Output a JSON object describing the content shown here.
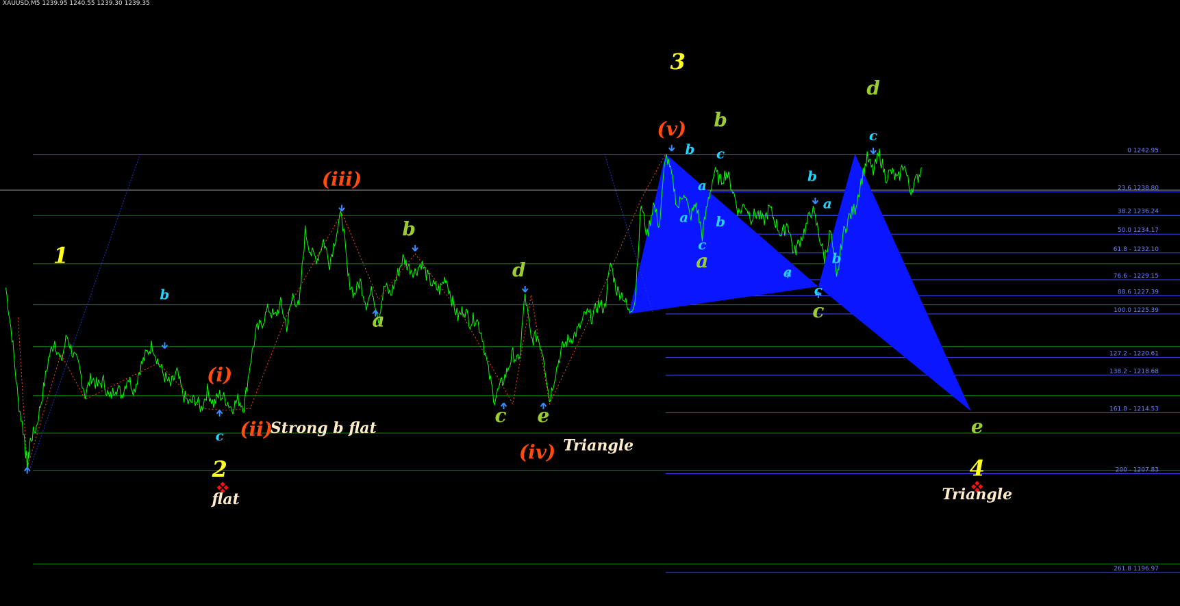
{
  "header": {
    "symbol_line": "XAUUSD,M5  1239.95 1240.55 1239.30 1239.35"
  },
  "colors": {
    "background": "#000000",
    "price": "#00ff00",
    "fib_line": "#3a4cff",
    "fib_text": "#6f82ff",
    "level_line": "#0a8a0a",
    "zigzag": "#ff4a1a",
    "pattern_fill": "#0a16ff",
    "primary_label": "#ffff22",
    "intermediate_label": "#ff4a10",
    "minor_label": "#9ccc34",
    "minute_label": "#22d4ff",
    "comment": "#ffeccc",
    "arrow": "#3a8cff",
    "marker": "#ff1010"
  },
  "chart_data": {
    "type": "line",
    "title": "",
    "xlabel": "",
    "ylabel": "",
    "ylim": [
      1195.5,
      1260.5
    ],
    "fib_levels": [
      {
        "label": "0 1242.95",
        "value": 1242.95
      },
      {
        "label": "23.6 1238.80",
        "value": 1238.8
      },
      {
        "label": "38.2 1236.24",
        "value": 1236.24
      },
      {
        "label": "50.0 1234.17",
        "value": 1234.17
      },
      {
        "label": "61.8 - 1232.10",
        "value": 1232.1
      },
      {
        "label": "76.6 - 1229.15",
        "value": 1229.15
      },
      {
        "label": "88.6 1227.39",
        "value": 1227.39
      },
      {
        "label": "100.0 1225.39",
        "value": 1225.39
      },
      {
        "label": "127.2 - 1220.61",
        "value": 1220.61
      },
      {
        "label": "138.2 - 1218.68",
        "value": 1218.68
      },
      {
        "label": "161.8 - 1214.53",
        "value": 1214.53
      },
      {
        "label": "200 - 1207.83",
        "value": 1207.83
      },
      {
        "label": "261.8 1196.97",
        "value": 1196.97
      }
    ],
    "horizontal_levels": [
      1242.95,
      1236.2,
      1230.9,
      1226.4,
      1221.8,
      1216.4,
      1212.3,
      1208.2,
      1197.9
    ],
    "current_price": 1239.0,
    "price_path": [
      [
        0,
        1228.3
      ],
      [
        1,
        1223.0
      ],
      [
        2,
        1216.0
      ],
      [
        3,
        1212.0
      ],
      [
        3.5,
        1208.5
      ],
      [
        4,
        1211.5
      ],
      [
        5,
        1213.0
      ],
      [
        6,
        1216.5
      ],
      [
        7,
        1220.5
      ],
      [
        8,
        1222.5
      ],
      [
        9,
        1220.0
      ],
      [
        10,
        1223.0
      ],
      [
        11,
        1221.0
      ],
      [
        12,
        1219.5
      ],
      [
        13,
        1216.5
      ],
      [
        14,
        1218.5
      ],
      [
        15,
        1217.5
      ],
      [
        16,
        1218.0
      ],
      [
        17,
        1216.0
      ],
      [
        18,
        1217.5
      ],
      [
        19,
        1216.5
      ],
      [
        20,
        1218.5
      ],
      [
        21,
        1217.0
      ],
      [
        22,
        1219.5
      ],
      [
        23,
        1221.0
      ],
      [
        24,
        1222.0
      ],
      [
        25,
        1220.0
      ],
      [
        26,
        1218.5
      ],
      [
        27,
        1217.5
      ],
      [
        28,
        1219.0
      ],
      [
        29,
        1216.5
      ],
      [
        30,
        1215.5
      ],
      [
        31,
        1216.0
      ],
      [
        32,
        1215.0
      ],
      [
        33,
        1217.0
      ],
      [
        34,
        1215.5
      ],
      [
        35,
        1216.5
      ],
      [
        36,
        1216.0
      ],
      [
        37,
        1215.0
      ],
      [
        38,
        1216.0
      ],
      [
        39,
        1215.2
      ],
      [
        40,
        1220.0
      ],
      [
        41,
        1223.5
      ],
      [
        42,
        1224.5
      ],
      [
        43,
        1226.0
      ],
      [
        44,
        1225.0
      ],
      [
        45,
        1226.5
      ],
      [
        46,
        1224.0
      ],
      [
        47,
        1227.5
      ],
      [
        48,
        1226.0
      ],
      [
        49,
        1234.5
      ],
      [
        50,
        1232.0
      ],
      [
        51,
        1231.5
      ],
      [
        52,
        1233.5
      ],
      [
        53,
        1231.0
      ],
      [
        54,
        1234.0
      ],
      [
        55,
        1236.5
      ],
      [
        56,
        1229.5
      ],
      [
        57,
        1227.5
      ],
      [
        58,
        1229.0
      ],
      [
        59,
        1226.5
      ],
      [
        60,
        1228.0
      ],
      [
        61,
        1225.0
      ],
      [
        62,
        1228.5
      ],
      [
        63,
        1227.5
      ],
      [
        64,
        1229.5
      ],
      [
        65,
        1231.5
      ],
      [
        66,
        1230.5
      ],
      [
        67,
        1230.0
      ],
      [
        68,
        1231.0
      ],
      [
        69,
        1229.5
      ],
      [
        70,
        1228.5
      ],
      [
        71,
        1228.0
      ],
      [
        72,
        1229.5
      ],
      [
        73,
        1227.0
      ],
      [
        74,
        1225.0
      ],
      [
        75,
        1226.0
      ],
      [
        76,
        1224.5
      ],
      [
        77,
        1225.0
      ],
      [
        78,
        1223.0
      ],
      [
        79,
        1219.0
      ],
      [
        80,
        1216.0
      ],
      [
        81,
        1217.5
      ],
      [
        82,
        1219.0
      ],
      [
        83,
        1221.0
      ],
      [
        84,
        1220.0
      ],
      [
        85,
        1227.5
      ],
      [
        86,
        1222.5
      ],
      [
        87,
        1223.0
      ],
      [
        88,
        1221.0
      ],
      [
        89,
        1216.0
      ],
      [
        90,
        1219.0
      ],
      [
        91,
        1221.5
      ],
      [
        92,
        1222.5
      ],
      [
        93,
        1223.0
      ],
      [
        94,
        1224.0
      ],
      [
        95,
        1225.5
      ],
      [
        96,
        1225.0
      ],
      [
        97,
        1226.5
      ],
      [
        98,
        1226.0
      ],
      [
        99,
        1231.0
      ],
      [
        100,
        1228.0
      ],
      [
        101,
        1227.5
      ],
      [
        102,
        1225.5
      ],
      [
        103,
        1227.0
      ],
      [
        104,
        1237.5
      ],
      [
        105,
        1234.0
      ],
      [
        106,
        1237.5
      ],
      [
        107,
        1235.0
      ],
      [
        108,
        1243.0
      ],
      [
        109,
        1240.5
      ],
      [
        110,
        1237.0
      ],
      [
        111,
        1239.0
      ],
      [
        112,
        1236.0
      ],
      [
        113,
        1237.5
      ],
      [
        114,
        1234.0
      ],
      [
        115,
        1238.0
      ],
      [
        116,
        1241.0
      ],
      [
        117,
        1240.0
      ],
      [
        118,
        1241.0
      ],
      [
        119,
        1239.0
      ],
      [
        120,
        1236.5
      ],
      [
        121,
        1237.5
      ],
      [
        122,
        1236.0
      ],
      [
        123,
        1236.5
      ],
      [
        124,
        1235.5
      ],
      [
        125,
        1237.0
      ],
      [
        126,
        1235.5
      ],
      [
        127,
        1234.0
      ],
      [
        128,
        1235.5
      ],
      [
        129,
        1232.0
      ],
      [
        130,
        1233.5
      ],
      [
        131,
        1235.0
      ],
      [
        132,
        1237.0
      ],
      [
        133,
        1234.5
      ],
      [
        134,
        1231.5
      ],
      [
        135,
        1234.5
      ],
      [
        136,
        1229.0
      ],
      [
        137,
        1234.0
      ],
      [
        138,
        1236.0
      ],
      [
        139,
        1237.0
      ],
      [
        140,
        1240.0
      ],
      [
        141,
        1242.5
      ],
      [
        142,
        1241.0
      ],
      [
        143,
        1243.0
      ],
      [
        144,
        1240.5
      ],
      [
        145,
        1241.0
      ],
      [
        146,
        1240.0
      ],
      [
        147,
        1242.0
      ],
      [
        148,
        1239.0
      ],
      [
        149,
        1240.0
      ],
      [
        150,
        1241.5
      ]
    ],
    "zigzag": [
      [
        2,
        1225.0
      ],
      [
        3.5,
        1208.5
      ],
      [
        9,
        1221.0
      ],
      [
        13,
        1216.0
      ],
      [
        25,
        1220.0
      ],
      [
        32,
        1215.0
      ],
      [
        36,
        1214.8
      ],
      [
        40,
        1215.0
      ],
      [
        47,
        1227.0
      ],
      [
        55,
        1236.5
      ],
      [
        61,
        1227.0
      ],
      [
        67,
        1232.0
      ],
      [
        75,
        1225.0
      ],
      [
        83,
        1215.5
      ],
      [
        86,
        1227.5
      ],
      [
        89,
        1215.5
      ],
      [
        96,
        1225.5
      ],
      [
        104,
        1238.0
      ],
      [
        108,
        1243.0
      ]
    ],
    "trendlines": [
      {
        "from": [
          4,
          1208.5
        ],
        "to": [
          22,
          1243.0
        ]
      },
      {
        "from": [
          98,
          1243.0
        ],
        "to": [
          106,
          1225.4
        ]
      }
    ],
    "harmonic_pattern": [
      [
        102,
        1225.4
      ],
      [
        108,
        1243.0
      ],
      [
        133,
        1228.4
      ],
      [
        139,
        1243.0
      ],
      [
        158,
        1214.7
      ]
    ],
    "labels": [
      {
        "text": "1",
        "x": 9,
        "y": 1231.0,
        "level": "primary"
      },
      {
        "text": "2",
        "x": 35,
        "y": 1207.5,
        "level": "primary"
      },
      {
        "text": "3",
        "x": 110,
        "y": 1252.3,
        "level": "primary"
      },
      {
        "text": "4",
        "x": 159,
        "y": 1207.6,
        "level": "primary"
      },
      {
        "text": "(i)",
        "x": 35,
        "y": 1218.0,
        "level": "intermediate"
      },
      {
        "text": "(ii)",
        "x": 41,
        "y": 1212.0,
        "level": "intermediate"
      },
      {
        "text": "(iii)",
        "x": 55,
        "y": 1239.5,
        "level": "intermediate"
      },
      {
        "text": "(iv)",
        "x": 87,
        "y": 1209.5,
        "level": "intermediate"
      },
      {
        "text": "(v)",
        "x": 109,
        "y": 1245.0,
        "level": "intermediate"
      },
      {
        "text": "b",
        "x": 26,
        "y": 1227.0,
        "level": "minute"
      },
      {
        "text": "c",
        "x": 35,
        "y": 1211.5,
        "level": "minute"
      },
      {
        "text": "b",
        "x": 66,
        "y": 1234.0,
        "level": "minor"
      },
      {
        "text": "a",
        "x": 61,
        "y": 1224.0,
        "level": "minor"
      },
      {
        "text": "d",
        "x": 84,
        "y": 1229.5,
        "level": "minor"
      },
      {
        "text": "c",
        "x": 81,
        "y": 1213.5,
        "level": "minor"
      },
      {
        "text": "e",
        "x": 88,
        "y": 1213.5,
        "level": "minor"
      },
      {
        "text": "b",
        "x": 117,
        "y": 1246.0,
        "level": "minor"
      },
      {
        "text": "a",
        "x": 114,
        "y": 1230.5,
        "level": "minor"
      },
      {
        "text": "c",
        "x": 133,
        "y": 1225.0,
        "level": "minor"
      },
      {
        "text": "d",
        "x": 142,
        "y": 1249.5,
        "level": "minor"
      },
      {
        "text": "e",
        "x": 159,
        "y": 1212.3,
        "level": "minor"
      },
      {
        "text": "b",
        "x": 112,
        "y": 1243.0,
        "level": "minute"
      },
      {
        "text": "c",
        "x": 117,
        "y": 1242.5,
        "level": "minute"
      },
      {
        "text": "a",
        "x": 114,
        "y": 1239.0,
        "level": "minute"
      },
      {
        "text": "a",
        "x": 111,
        "y": 1235.5,
        "level": "minute"
      },
      {
        "text": "b",
        "x": 117,
        "y": 1235.0,
        "level": "minute"
      },
      {
        "text": "c",
        "x": 114,
        "y": 1232.5,
        "level": "minute"
      },
      {
        "text": "b",
        "x": 132,
        "y": 1240.0,
        "level": "minute"
      },
      {
        "text": "a",
        "x": 134.5,
        "y": 1237.0,
        "level": "minute"
      },
      {
        "text": "a",
        "x": 128,
        "y": 1229.5,
        "level": "minute"
      },
      {
        "text": "c",
        "x": 133,
        "y": 1227.5,
        "level": "minute"
      },
      {
        "text": "b",
        "x": 136,
        "y": 1231.0,
        "level": "minute"
      },
      {
        "text": "c",
        "x": 142,
        "y": 1244.5,
        "level": "minute"
      }
    ],
    "comments": [
      {
        "text": "Strong b flat",
        "x": 52,
        "y": 1212.3
      },
      {
        "text": "Triangle",
        "x": 97,
        "y": 1210.4
      },
      {
        "text": "flat",
        "x": 36,
        "y": 1204.5
      },
      {
        "text": "Triangle",
        "x": 159,
        "y": 1205.0
      }
    ],
    "arrows": [
      {
        "x": 3.5,
        "y": 1208.5,
        "dir": "up"
      },
      {
        "x": 35,
        "y": 1214.8,
        "dir": "up"
      },
      {
        "x": 26,
        "y": 1221.6,
        "dir": "down"
      },
      {
        "x": 55,
        "y": 1236.7,
        "dir": "down"
      },
      {
        "x": 60.5,
        "y": 1225.8,
        "dir": "up"
      },
      {
        "x": 67,
        "y": 1232.3,
        "dir": "down"
      },
      {
        "x": 81.5,
        "y": 1215.6,
        "dir": "up"
      },
      {
        "x": 85,
        "y": 1227.8,
        "dir": "down"
      },
      {
        "x": 88,
        "y": 1215.6,
        "dir": "up"
      },
      {
        "x": 109,
        "y": 1243.3,
        "dir": "down"
      },
      {
        "x": 128,
        "y": 1230.0,
        "dir": "up"
      },
      {
        "x": 133,
        "y": 1227.8,
        "dir": "up"
      },
      {
        "x": 132.5,
        "y": 1237.5,
        "dir": "down"
      },
      {
        "x": 142,
        "y": 1243.0,
        "dir": "down"
      }
    ],
    "markers": [
      {
        "x": 35.5,
        "y": 1206.3
      },
      {
        "x": 159,
        "y": 1206.4
      }
    ]
  }
}
